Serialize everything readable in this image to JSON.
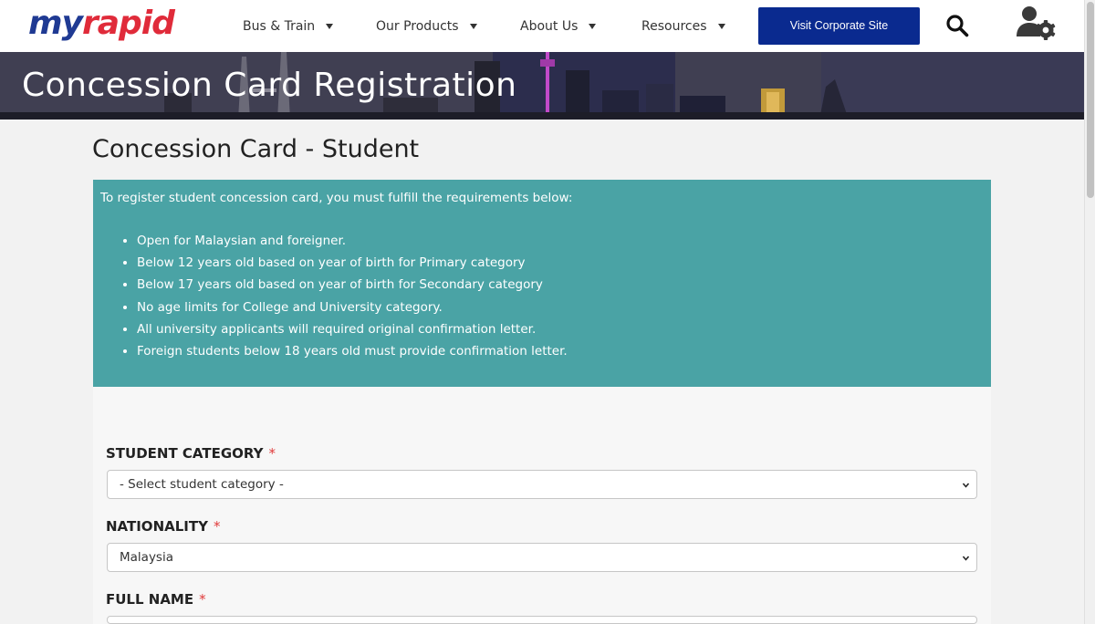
{
  "header": {
    "logo": {
      "part1": "my",
      "part2": "rapid"
    },
    "nav": [
      {
        "label": "Bus & Train"
      },
      {
        "label": "Our Products"
      },
      {
        "label": "About Us"
      },
      {
        "label": "Resources"
      }
    ],
    "corporate_button": "Visit Corporate Site",
    "icons": [
      "search-icon",
      "user-settings-icon"
    ]
  },
  "banner": {
    "title": "Concession Card Registration"
  },
  "page": {
    "title": "Concession Card - Student",
    "info": {
      "intro": "To register student concession card, you must fulfill the requirements below:",
      "requirements": [
        "Open for Malaysian and foreigner.",
        "Below 12 years old based on year of birth for Primary category",
        "Below 17 years old based on year of birth for Secondary category",
        "No age limits for College and University category.",
        "All university applicants will required original confirmation letter.",
        "Foreign students below 18 years old must provide confirmation letter."
      ]
    },
    "form": {
      "student_category": {
        "label": "STUDENT CATEGORY",
        "required_mark": "*",
        "value": "- Select student category -"
      },
      "nationality": {
        "label": "NATIONALITY",
        "required_mark": "*",
        "value": "Malaysia"
      },
      "full_name": {
        "label": "FULL NAME",
        "required_mark": "*",
        "value": ""
      }
    }
  },
  "colors": {
    "brand_blue": "#1f3a93",
    "brand_red": "#e02b3a",
    "corporate_button": "#0a2a8f",
    "info_box": "#4aa3a5",
    "required": "#e03a3a"
  }
}
